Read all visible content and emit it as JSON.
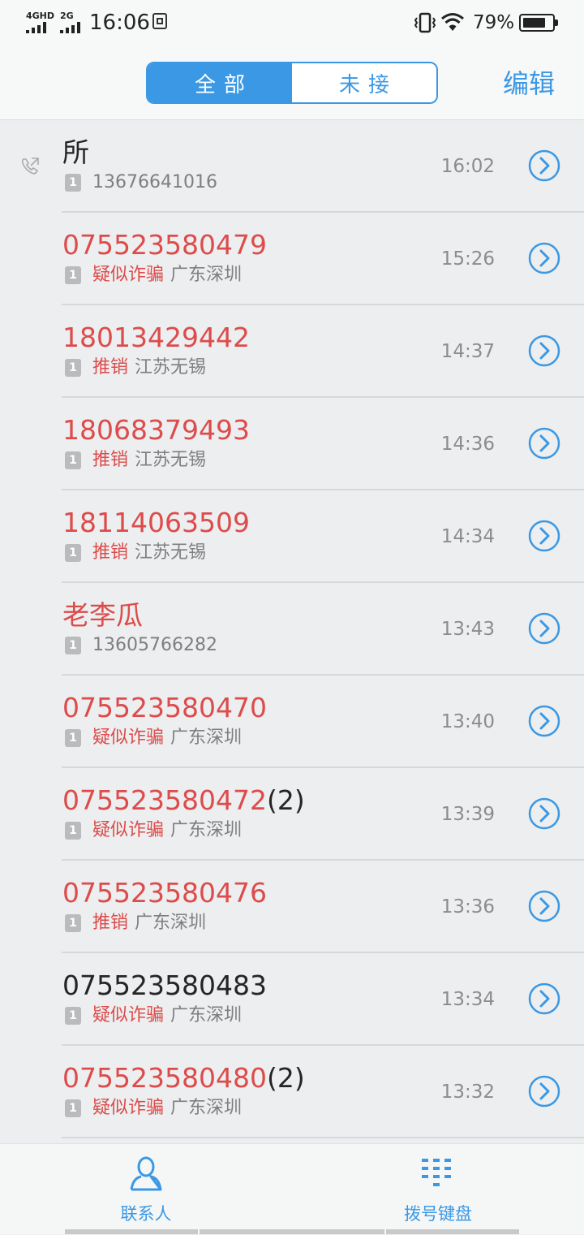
{
  "status_bar": {
    "sim1_label": "4GHD",
    "sim2_label": "2G",
    "time": "16:06",
    "battery_percent": "79%",
    "battery_level": 0.79
  },
  "header": {
    "tabs": [
      {
        "label": "全部",
        "active": true
      },
      {
        "label": "未接",
        "active": false
      }
    ],
    "edit_label": "编辑"
  },
  "calls": [
    {
      "name": "所",
      "count": "",
      "sim": "1",
      "tag": "",
      "detail": "13676641016",
      "time": "16:02",
      "missed": false,
      "call_icon": "outgoing-call-icon"
    },
    {
      "name": "075523580479",
      "count": "",
      "sim": "1",
      "tag": "疑似诈骗",
      "detail": "广东深圳",
      "time": "15:26",
      "missed": true
    },
    {
      "name": "18013429442",
      "count": "",
      "sim": "1",
      "tag": "推销",
      "detail": "江苏无锡",
      "time": "14:37",
      "missed": true
    },
    {
      "name": "18068379493",
      "count": "",
      "sim": "1",
      "tag": "推销",
      "detail": "江苏无锡",
      "time": "14:36",
      "missed": true
    },
    {
      "name": "18114063509",
      "count": "",
      "sim": "1",
      "tag": "推销",
      "detail": "江苏无锡",
      "time": "14:34",
      "missed": true
    },
    {
      "name": "老李瓜",
      "count": "",
      "sim": "1",
      "tag": "",
      "detail": "13605766282",
      "time": "13:43",
      "missed": true
    },
    {
      "name": "075523580470",
      "count": "",
      "sim": "1",
      "tag": "疑似诈骗",
      "detail": "广东深圳",
      "time": "13:40",
      "missed": true
    },
    {
      "name": "075523580472",
      "count": "(2)",
      "sim": "1",
      "tag": "疑似诈骗",
      "detail": "广东深圳",
      "time": "13:39",
      "missed": true
    },
    {
      "name": "075523580476",
      "count": "",
      "sim": "1",
      "tag": "推销",
      "detail": "广东深圳",
      "time": "13:36",
      "missed": true
    },
    {
      "name": "075523580483",
      "count": "",
      "sim": "1",
      "tag": "疑似诈骗",
      "detail": "广东深圳",
      "time": "13:34",
      "missed": false
    },
    {
      "name": "075523580480",
      "count": "(2)",
      "sim": "1",
      "tag": "疑似诈骗",
      "detail": "广东深圳",
      "time": "13:32",
      "missed": true
    }
  ],
  "bottom_nav": {
    "contacts_label": "联系人",
    "dialpad_label": "拨号键盘"
  },
  "colors": {
    "accent": "#3a98e4",
    "missed": "#dd4b4b"
  }
}
